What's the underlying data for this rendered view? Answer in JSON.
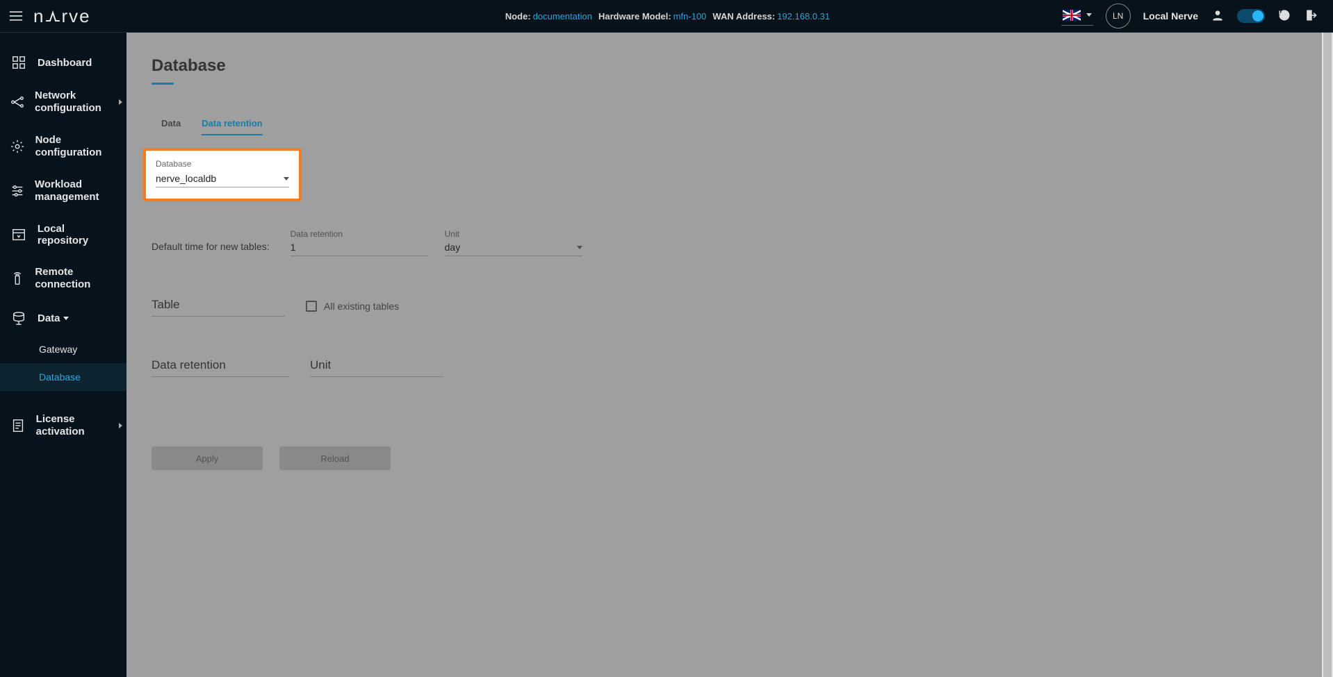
{
  "topbar": {
    "node_label": "Node:",
    "node_value": "documentation",
    "hw_label": "Hardware Model:",
    "hw_value": "mfn-100",
    "wan_label": "WAN Address:",
    "wan_value": "192.168.0.31",
    "ln_badge": "LN",
    "local_nerve": "Local Nerve"
  },
  "sidebar": {
    "items": [
      {
        "label": "Dashboard"
      },
      {
        "label": "Network configuration"
      },
      {
        "label": "Node configuration"
      },
      {
        "label": "Workload management"
      },
      {
        "label": "Local repository"
      },
      {
        "label": "Remote connection"
      },
      {
        "label": "Data"
      },
      {
        "label": "License activation"
      }
    ],
    "sub": {
      "gateway": "Gateway",
      "database": "Database"
    }
  },
  "page": {
    "title": "Database",
    "tabs": {
      "data": "Data",
      "retention": "Data retention"
    },
    "db_field": {
      "label": "Database",
      "value": "nerve_localdb"
    },
    "default_time_label": "Default time for new tables:",
    "retention_field": {
      "label": "Data retention",
      "value": "1"
    },
    "unit_field": {
      "label": "Unit",
      "value": "day"
    },
    "table_select": "Table",
    "all_tables": "All existing tables",
    "retention2": "Data retention",
    "unit2": "Unit",
    "apply": "Apply",
    "reload": "Reload"
  }
}
